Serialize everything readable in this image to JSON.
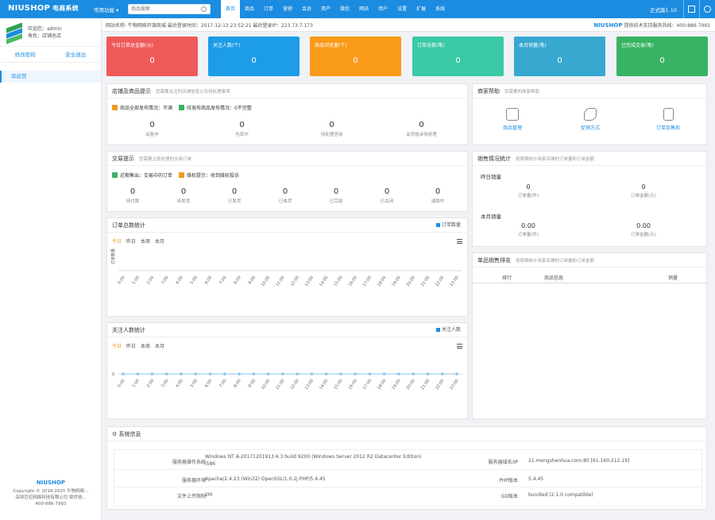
{
  "header": {
    "logo": "NIUSHOP",
    "logo_sub": "电商系统",
    "quick_menu": "常用功能",
    "search_placeholder": "商品搜索",
    "version": "正式版1.10",
    "nav": [
      "首页",
      "商品",
      "订单",
      "营销",
      "会员",
      "资产",
      "微信",
      "网站",
      "用户",
      "设置",
      "扩展",
      "系统"
    ]
  },
  "sidebar": {
    "welcome": "欢迎您：admin",
    "role": "角色：店铺总店",
    "btn_password": "修改密码",
    "btn_logout": "安全退出",
    "menu": [
      "欢迎页"
    ],
    "footer_logo": "NIUSHOP",
    "footer_copy": "Copyright © 2016-2025 牛物网络...",
    "footer_company": "深圳巨应网络科技有限公司 提供技...",
    "footer_phone": "400-886-7993"
  },
  "infobar": {
    "left": "网站名称: 牛物网络开源商城    最后登录时间：2017-12-13 23:52:21    最后登录IP：223.73.7.173",
    "brand": "NIUSHOP",
    "right": "提供技术支持服务热线：400-886-7993"
  },
  "cards": [
    {
      "title": "今日订单总金额(元)",
      "value": "0",
      "color": "#ee5a5a"
    },
    {
      "title": "关注人数(个)",
      "value": "0",
      "color": "#1d9de8"
    },
    {
      "title": "商品浏览量(个)",
      "value": "0",
      "color": "#f99a19"
    },
    {
      "title": "订单总数(笔)",
      "value": "0",
      "color": "#3ac9a5"
    },
    {
      "title": "本月销量(笔)",
      "value": "0",
      "color": "#37a8cf"
    },
    {
      "title": "已完成交易(笔)",
      "value": "0",
      "color": "#38b363"
    }
  ],
  "goods_panel": {
    "title": "店铺及商品提示",
    "sub": "您需要关注的店铺信息以及待处理事项",
    "tag1": "商品全部发布情况：不满",
    "tag2": "待发布商品发布情况：0不完整",
    "stats": [
      {
        "n": "0",
        "l": "出售中"
      },
      {
        "n": "0",
        "l": "仓库中"
      },
      {
        "n": "0",
        "l": "待处理咨询"
      },
      {
        "n": "0",
        "l": "会员投诉待处理"
      }
    ]
  },
  "trade_panel": {
    "title": "交易提示",
    "sub": "您需要立即处理的交易订单",
    "tag1": "近期售出：交易中的订单",
    "tag2": "维权提示：收到维权投诉",
    "stats": [
      {
        "n": "0",
        "l": "待付款"
      },
      {
        "n": "0",
        "l": "待发货"
      },
      {
        "n": "0",
        "l": "已发货"
      },
      {
        "n": "0",
        "l": "已收货"
      },
      {
        "n": "0",
        "l": "已完成"
      },
      {
        "n": "0",
        "l": "已关闭"
      },
      {
        "n": "0",
        "l": "退款中"
      }
    ]
  },
  "chart1": {
    "title": "订单总数统计",
    "legend": "订单数量",
    "tabs": [
      "今日",
      "昨日",
      "本周",
      "本月"
    ],
    "ylabel": "订单数量"
  },
  "chart2": {
    "title": "关注人数统计",
    "legend": "关注人数",
    "tabs": [
      "今日",
      "昨日",
      "本周",
      "本月"
    ]
  },
  "help": {
    "title": "商家帮助",
    "sub": "您需要的商家帮助",
    "items": [
      "商品管理",
      "促销方式",
      "订单及售后"
    ]
  },
  "sales": {
    "title": "销售情况统计",
    "sub": "按周期统计商家店铺的订单量和订单金额",
    "today_label": "昨日销量",
    "month_label": "本月销量",
    "today": [
      {
        "n": "0",
        "l": "订单量(件)"
      },
      {
        "n": "0",
        "l": "订单金额(元)"
      }
    ],
    "month": [
      {
        "n": "0.00",
        "l": "订单量(件)"
      },
      {
        "n": "0.00",
        "l": "订单金额(元)"
      }
    ]
  },
  "rank": {
    "title": "单品销售排名",
    "sub": "按周期统计商家店铺的订单量和订单金额",
    "cols": [
      "排行",
      "商品信息",
      "销量"
    ]
  },
  "sys": {
    "title": "系统信息",
    "rows": [
      {
        "k1": "服务器操作系统",
        "v1": "Windows NT A-20171201913 6.3 build 9200 (Windows Server 2012 R2 Datacenter Edition) i586",
        "k2": "服务器域名/IP",
        "v2": "21.mengshenhua.com:80 [61.160.212.19]"
      },
      {
        "k1": "服务器环境",
        "v1": "Apache/2.4.23 (Win32) OpenSSL/1.0.2j PHP/5.4.45",
        "k2": "PHP版本",
        "v2": "5.4.45"
      },
      {
        "k1": "文件上传限制",
        "v1": "2M",
        "k2": "GD版本",
        "v2": "bundled (2.1.0 compatible)"
      }
    ]
  },
  "chart_data": [
    {
      "type": "line",
      "title": "订单总数统计",
      "series": [
        {
          "name": "订单数量",
          "values": [
            0,
            0,
            0,
            0,
            0,
            0,
            0,
            0,
            0,
            0,
            0,
            0,
            0,
            0,
            0,
            0,
            0,
            0,
            0,
            0,
            0,
            0,
            0,
            0
          ]
        }
      ],
      "categories": [
        "0:00",
        "1:00",
        "2:00",
        "3:00",
        "4:00",
        "5:00",
        "6:00",
        "7:00",
        "8:00",
        "9:00",
        "10:00",
        "11:00",
        "12:00",
        "13:00",
        "14:00",
        "15:00",
        "16:00",
        "17:00",
        "18:00",
        "19:00",
        "20:00",
        "21:00",
        "22:00",
        "23:00"
      ],
      "ylabel": "订单数量"
    },
    {
      "type": "line",
      "title": "关注人数统计",
      "series": [
        {
          "name": "关注人数",
          "values": [
            0,
            0,
            0,
            0,
            0,
            0,
            0,
            0,
            0,
            0,
            0,
            0,
            0,
            0,
            0,
            0,
            0,
            0,
            0,
            0,
            0,
            0,
            0,
            0
          ]
        }
      ],
      "categories": [
        "0:00",
        "1:00",
        "2:00",
        "3:00",
        "4:00",
        "5:00",
        "6:00",
        "7:00",
        "8:00",
        "9:00",
        "10:00",
        "11:00",
        "12:00",
        "13:00",
        "14:00",
        "15:00",
        "16:00",
        "17:00",
        "18:00",
        "19:00",
        "20:00",
        "21:00",
        "22:00",
        "23:00"
      ],
      "yticks": [
        "0"
      ]
    }
  ]
}
